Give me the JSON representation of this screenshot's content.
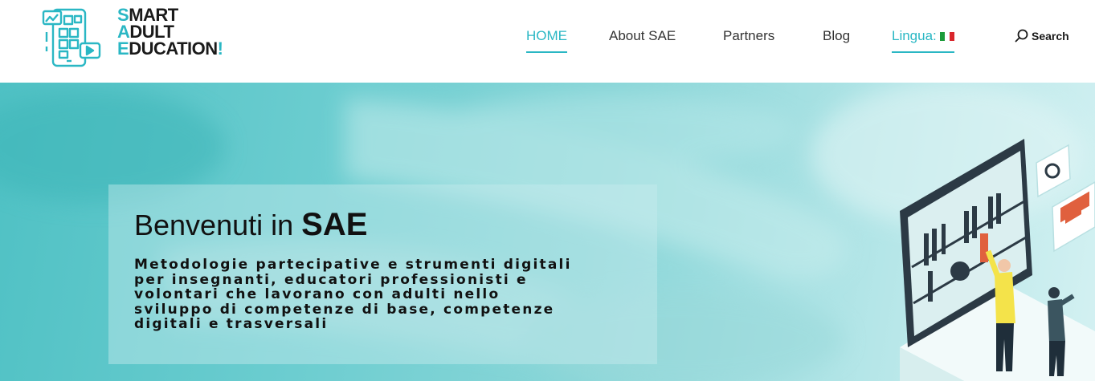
{
  "logo": {
    "lines": [
      {
        "cap": "S",
        "rest": "MART"
      },
      {
        "cap": "A",
        "rest": "DULT"
      },
      {
        "cap": "E",
        "rest": "DUCATION"
      }
    ],
    "exclamation": "!"
  },
  "nav": {
    "items": [
      {
        "label": "HOME"
      },
      {
        "label": "About SAE"
      },
      {
        "label": "Partners"
      },
      {
        "label": "Blog"
      },
      {
        "label": "Lingua:"
      }
    ],
    "search_label": "Search"
  },
  "hero": {
    "title_prefix": "Benvenuti in",
    "title_bold": "SAE",
    "subtitle_lines": [
      "Metodologie partecipative e strumenti digitali",
      "per insegnanti, educatori professionisti e",
      "volontari che lavorano con adulti nello",
      "sviluppo di competenze di base, competenze",
      "digitali e trasversali"
    ]
  },
  "colors": {
    "accent": "#2ab7c4",
    "hero_start": "#4fc1c4",
    "hero_end": "#d4f1f2",
    "flag": [
      "#1c9b3a",
      "#ffffff",
      "#d9262c"
    ]
  },
  "icons": {
    "logo": "tablet-app-grid-icon",
    "search": "search-icon",
    "flag": "italy-flag-icon"
  }
}
